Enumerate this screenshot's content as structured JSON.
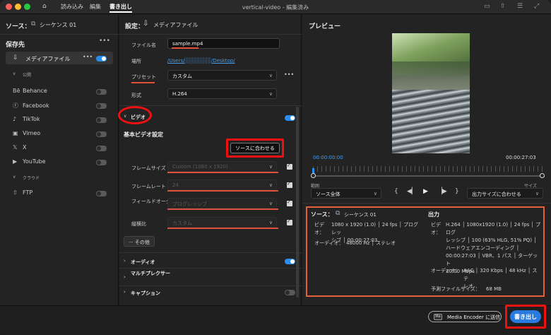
{
  "titlebar": {
    "tabs": [
      "読み込み",
      "編集",
      "書き出し"
    ],
    "title": "vertical-video - 編集済み"
  },
  "left": {
    "source_label": "ソース：",
    "source_name": "シーケンス 01",
    "destinations_header": "保存先",
    "media_file": "メディアファイル",
    "public_header": "公開",
    "services": [
      "Behance",
      "Facebook",
      "TikTok",
      "Vimeo",
      "X",
      "YouTube"
    ],
    "cloud_header": "クラウド",
    "ftp": "FTP"
  },
  "settings": {
    "header_label": "設定：",
    "header_title": "メディアファイル",
    "filename_label": "ファイル名",
    "filename_value": "sample.mp4",
    "location_label": "場所",
    "location_value": "/Users/░░░░░░░/Desktop/",
    "preset_label": "プリセット",
    "preset_value": "カスタム",
    "format_label": "形式",
    "format_value": "H.264",
    "video_section": "ビデオ",
    "basic_video": "基本ビデオ設定",
    "match_source": "ソースに合わせる",
    "frame_size_label": "フレームサイズ",
    "frame_size_value": "Custom (1080 x 1920)",
    "frame_rate_label": "フレームレート",
    "frame_rate_value": "24",
    "field_order_label": "フィールドオーダー",
    "field_order_value": "プログレッシブ",
    "aspect_label": "縦横比",
    "aspect_value": "カスタム",
    "more": "その他",
    "audio_section": "オーディオ",
    "multiplexer_section": "マルチプレクサー",
    "caption_section": "キャプション"
  },
  "preview": {
    "header": "プレビュー",
    "time_start": "00:00:00:00",
    "time_end": "00:00:27:03",
    "range_label": "範囲",
    "range_value": "ソース全体",
    "size_label": "サイズ",
    "size_value": "出力サイズに合わせる"
  },
  "summary": {
    "source_label": "ソース：",
    "source_name": "シーケンス 01",
    "video_label": "ビデオ：",
    "video_line1": "1080 x 1920 (1.0) │ 24 fps │ プログレッ",
    "video_line2": "シブ │ 00:00:27:03",
    "audio_label": "オーディオ：",
    "audio_value": "48000 Hz │ ステレオ",
    "output_header": "出力",
    "out_video_label": "ビデオ：",
    "out_video_lines": [
      "H.264 │ 1080x1920 (1.0) │ 24 fps │ プログ",
      "レッシブ │ 100 (63% HLG, 51% PQ) │",
      "ハードウェアエンコーディング │",
      "00:00:27:03 │ VBR、1 パス │ ターゲット",
      "20.00 Mbps"
    ],
    "out_audio_label": "オーディオ：",
    "out_audio_lines": [
      "AAC │ 320 Kbps │ 48 kHz │ ステ",
      "レオ"
    ],
    "filesize_label": "予測ファイルサイズ：",
    "filesize_value": "68 MB"
  },
  "bottom": {
    "media_encoder": "Media Encoder に送信",
    "export": "書き出し"
  },
  "colors": {
    "accent": "#2a8ef0",
    "highlight": "#e11111",
    "underline": "#e0503a"
  }
}
